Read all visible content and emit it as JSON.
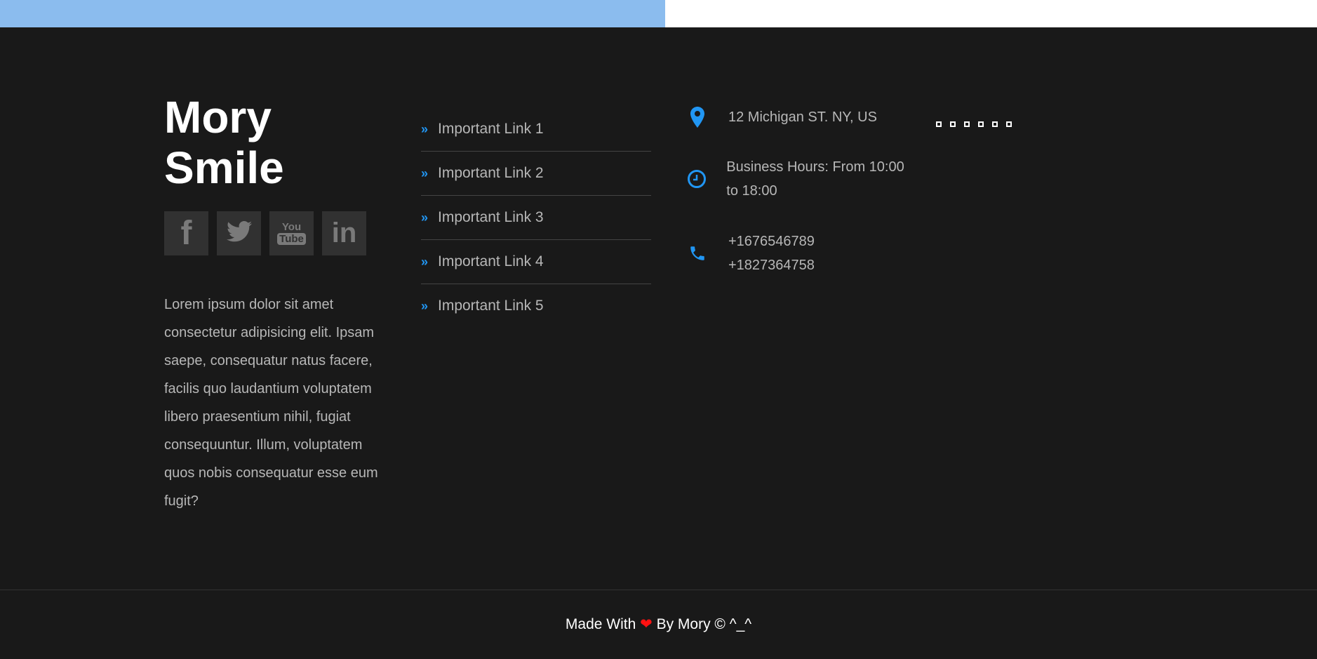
{
  "header": {
    "progress_percent": 50.5,
    "progress_color": "#8bbcee"
  },
  "brand": {
    "title": "Mory Smile"
  },
  "social": [
    {
      "name": "facebook-icon",
      "label": "f"
    },
    {
      "name": "twitter-icon",
      "label": "🐦"
    },
    {
      "name": "youtube-icon",
      "label": "You Tube"
    },
    {
      "name": "linkedin-icon",
      "label": "in"
    }
  ],
  "about": "Lorem ipsum dolor sit amet consectetur adipisicing elit. Ipsam saepe, consequatur natus facere, facilis quo laudantium voluptatem libero praesentium nihil, fugiat consequuntur. Illum, voluptatem quos nobis consequatur esse eum fugit?",
  "links": [
    {
      "label": "Important Link 1"
    },
    {
      "label": "Important Link 2"
    },
    {
      "label": "Important Link 3"
    },
    {
      "label": "Important Link 4"
    },
    {
      "label": "Important Link 5"
    }
  ],
  "contact": {
    "address": "12 Michigan ST. NY, US",
    "hours": "Business Hours: From 10:00 to 18:00",
    "phone1": "+1676546789",
    "phone2": "+1827364758"
  },
  "gallery": {
    "count": 6
  },
  "footer": {
    "made_with": "Made With",
    "by": "By Mory © ^_^"
  },
  "colors": {
    "accent": "#2196f3",
    "background": "#191919",
    "heart": "#ff1111"
  }
}
